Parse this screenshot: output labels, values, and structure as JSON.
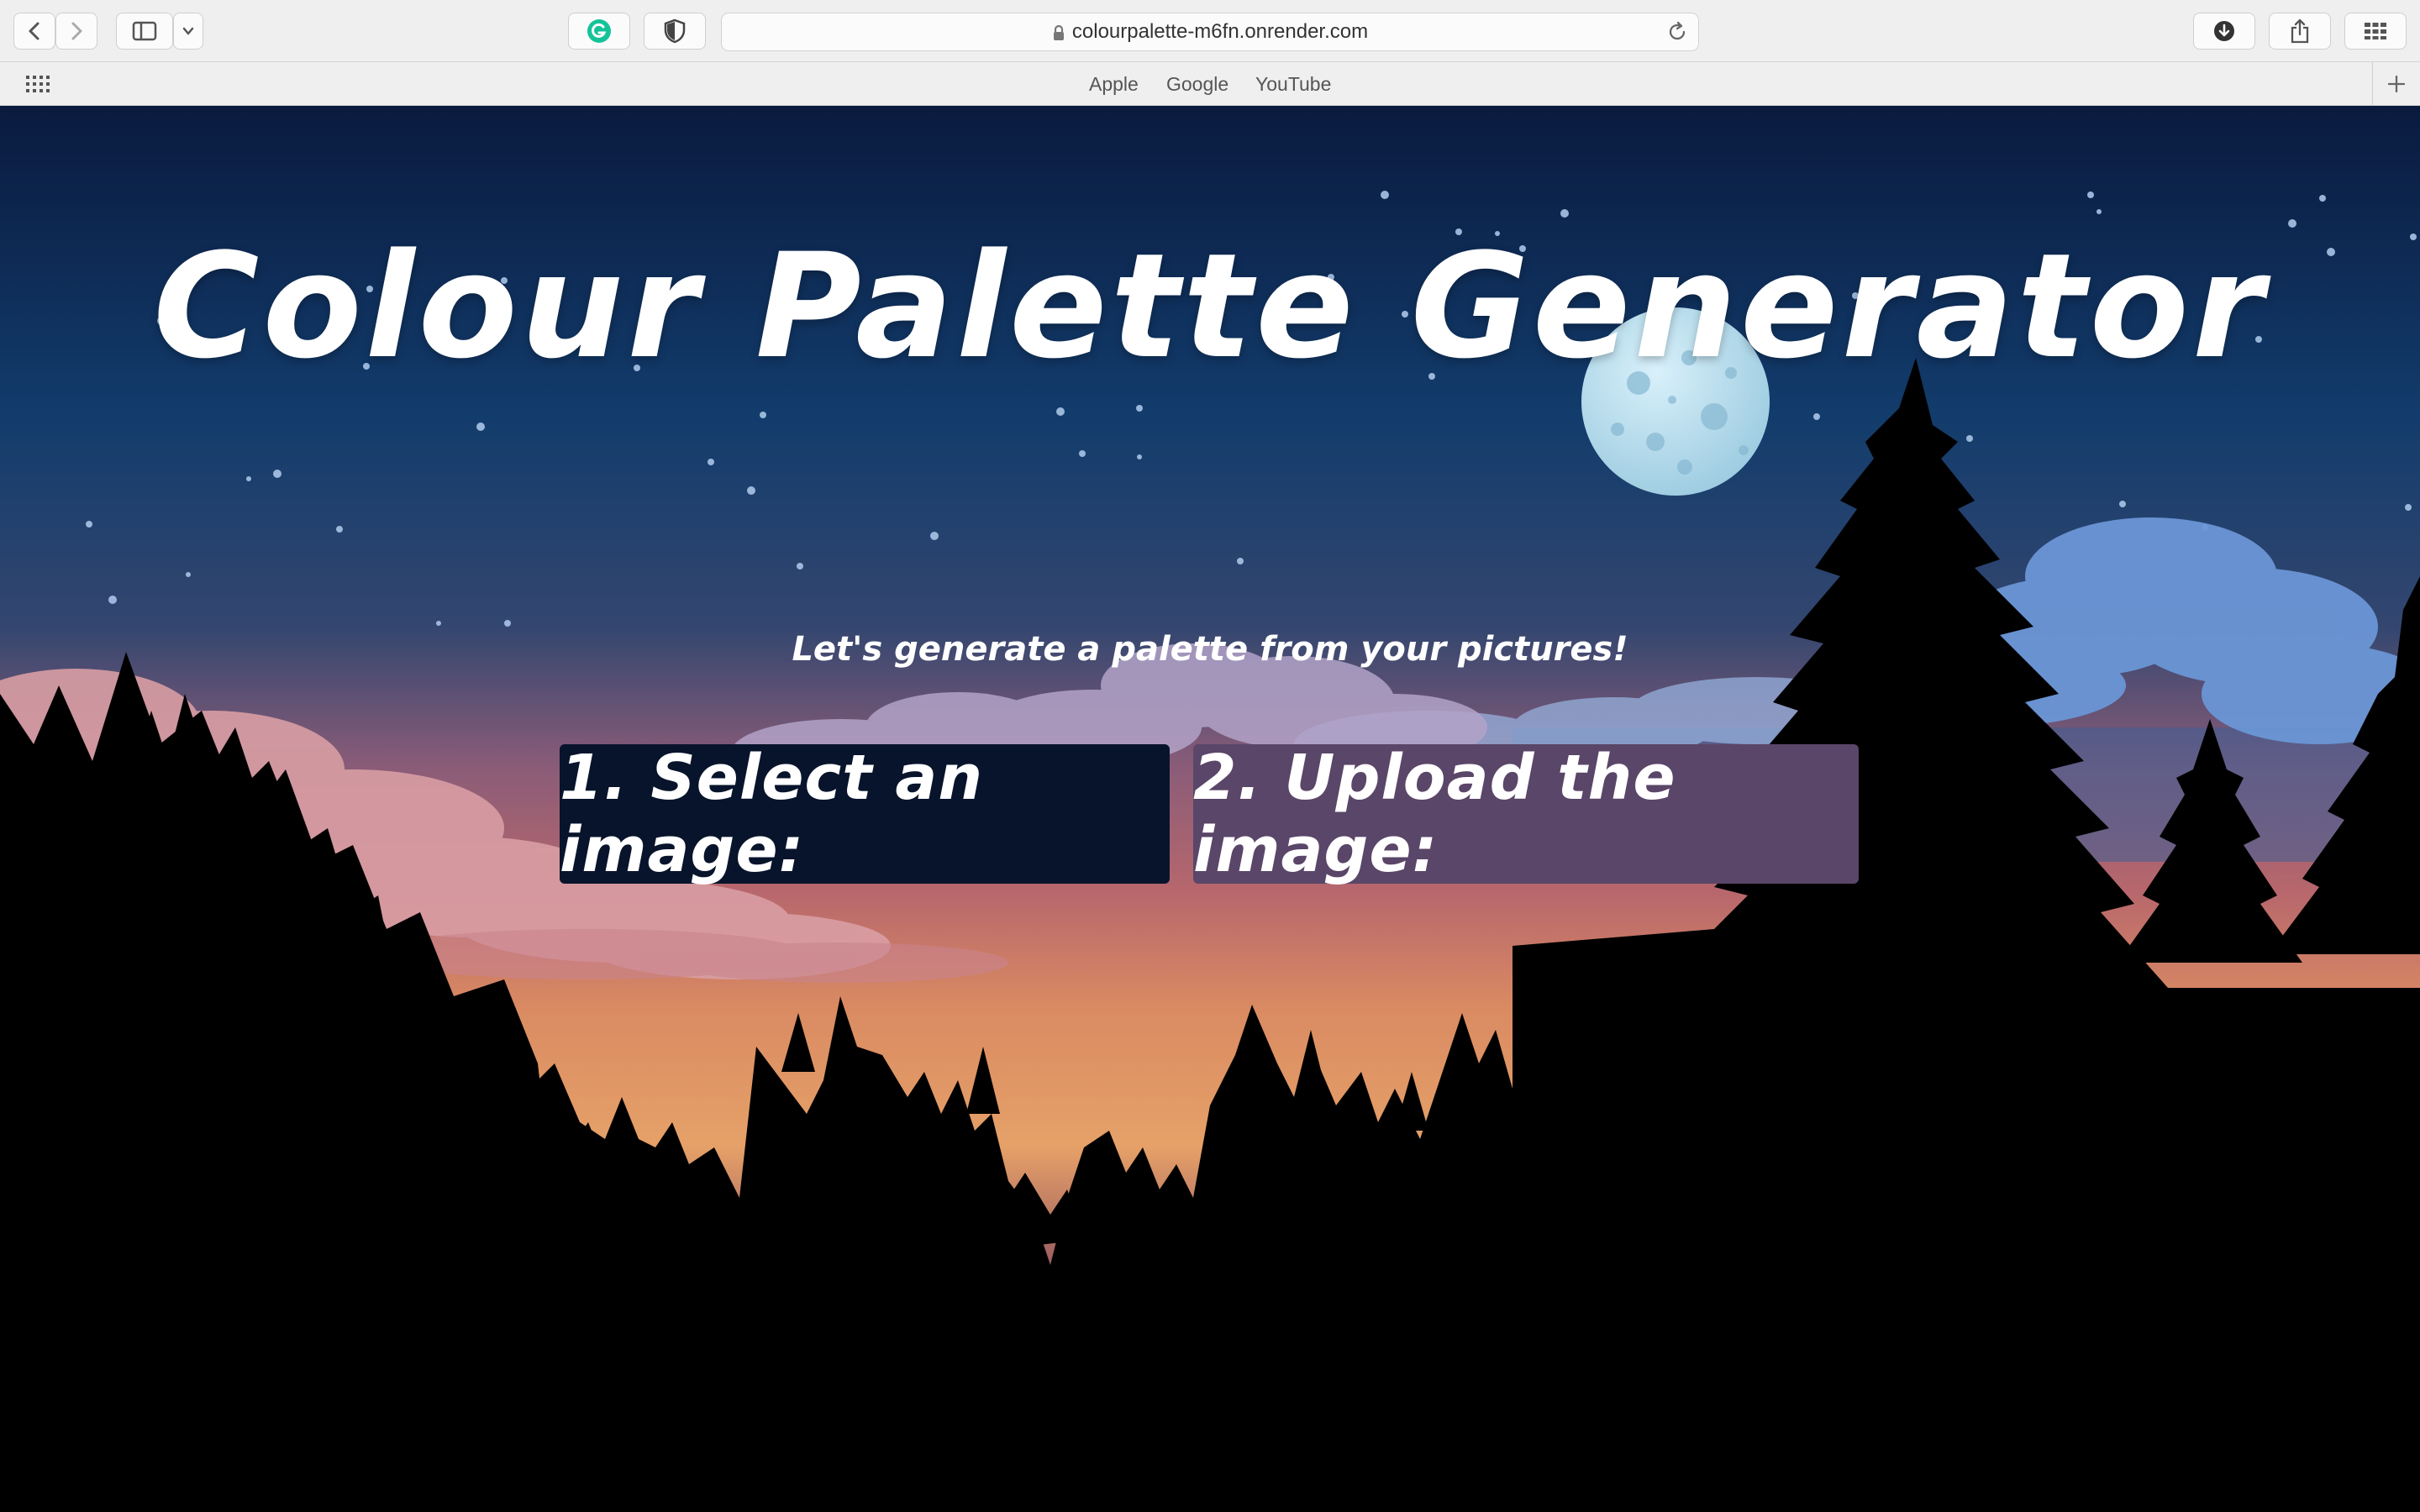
{
  "browser": {
    "url": "colourpalette-m6fn.onrender.com",
    "favorites": [
      "Apple",
      "Google",
      "YouTube"
    ],
    "icons": {
      "back": "chevron-left-icon",
      "forward": "chevron-right-icon",
      "sidebar": "sidebar-icon",
      "grammarly": "grammarly-icon",
      "privacy": "shield-icon",
      "lock": "lock-icon",
      "reload": "reload-icon",
      "downloads": "download-icon",
      "share": "share-icon",
      "tabs": "tab-overview-icon",
      "grid": "grid-icon",
      "new_tab": "plus-icon"
    }
  },
  "page": {
    "title": "Colour Palette Generator",
    "subtitle": "Let's generate a palette from your pictures!",
    "select_button": "1. Select an image:",
    "upload_button": "2. Upload the image:"
  },
  "colors": {
    "select_button_bg": "#08142c",
    "upload_button_bg": "#5a4668",
    "sky_top": "#0a1a3e",
    "sky_mid": "#123c6c",
    "horizon": "#e39a5e"
  }
}
